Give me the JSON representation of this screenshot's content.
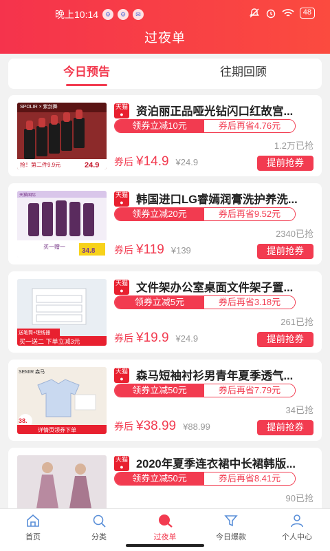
{
  "status": {
    "time": "晚上10:14",
    "mini_icons": [
      "⚙",
      "⚙",
      "✉"
    ],
    "battery": "48"
  },
  "header": {
    "title": "过夜单"
  },
  "tabs": [
    {
      "label": "今日预告",
      "active": true
    },
    {
      "label": "往期回顾",
      "active": false
    }
  ],
  "products": [
    {
      "title": "资泊丽正品哑光钻闪口红故宫...",
      "badge_top": "天猫",
      "coupon_left": "领券立减10元",
      "coupon_right": "券后再省4.76元",
      "sold": "1.2万已抢",
      "after_label": "券后",
      "price": "¥14.9",
      "orig_price": "¥24.9",
      "button": "提前抢券",
      "thumb_caption": "抢！第二件9.9元",
      "thumb_price": "24.9",
      "thumb_brand": "SPOLIR × 紫剑舞"
    },
    {
      "title": "韩国进口LG睿嫣润膏洗护养洗...",
      "badge_top": "天猫",
      "coupon_left": "领券立减20元",
      "coupon_right": "券后再省9.52元",
      "sold": "2340已抢",
      "after_label": "券后",
      "price": "¥119",
      "orig_price": "¥139",
      "button": "提前抢券",
      "thumb_caption": "买一赠一",
      "thumb_price": "34.8",
      "thumb_brand": "天猫国际"
    },
    {
      "title": "文件架办公室桌面文件架子置...",
      "badge_top": "天猫",
      "coupon_left": "领券立减5元",
      "coupon_right": "券后再省3.18元",
      "sold": "261已抢",
      "after_label": "券后",
      "price": "¥19.9",
      "orig_price": "¥24.9",
      "button": "提前抢券",
      "thumb_caption": "买一送二 下单立减3元",
      "thumb_price": "",
      "thumb_brand": "送笔筒+理线器"
    },
    {
      "title": "森马短袖衬衫男青年夏季透气...",
      "badge_top": "天猫",
      "coupon_left": "领券立减50元",
      "coupon_right": "券后再省7.79元",
      "sold": "34已抢",
      "after_label": "券后",
      "price": "¥38.99",
      "orig_price": "¥88.99",
      "button": "提前抢券",
      "thumb_caption": "详情页领券下单",
      "thumb_price": "38.",
      "thumb_brand": "SEMIR 森马"
    },
    {
      "title": "2020年夏季连衣裙中长裙韩版...",
      "badge_top": "天猫",
      "coupon_left": "领券立减50元",
      "coupon_right": "券后再省8.41元",
      "sold": "90已抢",
      "after_label": "券后",
      "price": "",
      "orig_price": "",
      "button": "",
      "thumb_caption": "",
      "thumb_price": "",
      "thumb_brand": ""
    }
  ],
  "nav": [
    {
      "label": "首页",
      "icon": "home-icon",
      "active": false
    },
    {
      "label": "分类",
      "icon": "search-icon",
      "active": false
    },
    {
      "label": "过夜单",
      "icon": "magnifier-filled-icon",
      "active": true
    },
    {
      "label": "今日爆款",
      "icon": "filter-icon",
      "active": false
    },
    {
      "label": "个人中心",
      "icon": "user-icon",
      "active": false
    }
  ],
  "colors": {
    "accent": "#f23b50",
    "header_start": "#f5334c",
    "header_end": "#fb4b3f"
  }
}
